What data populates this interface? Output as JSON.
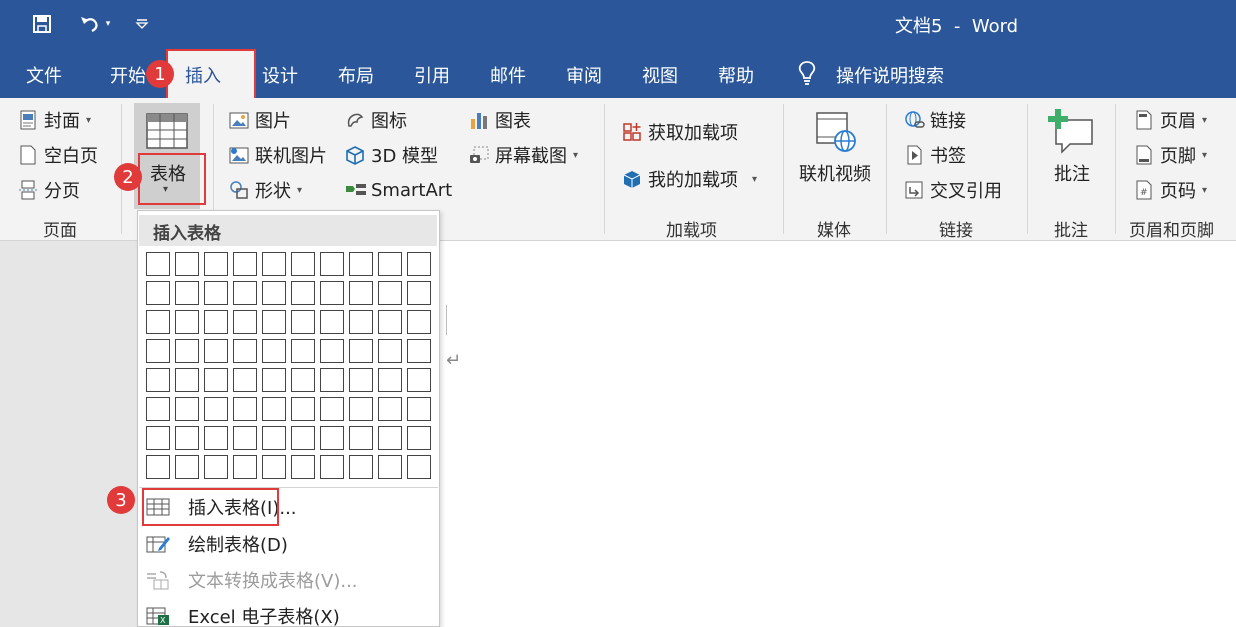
{
  "titlebar": {
    "title": "文档5  -  Word",
    "qat": {
      "save_icon": "save-icon",
      "undo_icon": "undo-icon",
      "customize_icon": "customize-qat-icon"
    }
  },
  "tabs": [
    "文件",
    "开始",
    "插入",
    "设计",
    "布局",
    "引用",
    "邮件",
    "审阅",
    "视图",
    "帮助"
  ],
  "active_tab": "插入",
  "tell_me": "操作说明搜索",
  "ribbon": {
    "pages": {
      "label": "页面",
      "cover": "封面",
      "blank": "空白页",
      "break": "分页"
    },
    "table": {
      "label": "表格"
    },
    "illustrations": {
      "picture": "图片",
      "online_picture": "联机图片",
      "shapes": "形状",
      "icons": "图标",
      "model_3d": "3D 模型",
      "smartart": "SmartArt",
      "chart": "图表",
      "screenshot": "屏幕截图"
    },
    "addins": {
      "label": "加载项",
      "get": "获取加载项",
      "mine": "我的加载项"
    },
    "media": {
      "label": "媒体",
      "online_video": "联机视频"
    },
    "links": {
      "label": "链接",
      "link": "链接",
      "bookmark": "书签",
      "cross_ref": "交叉引用"
    },
    "comments": {
      "label": "批注",
      "comment": "批注"
    },
    "header_footer": {
      "label": "页眉和页脚",
      "header": "页眉",
      "footer": "页脚",
      "page_number": "页码"
    }
  },
  "table_menu": {
    "header": "插入表格",
    "grid_columns": 10,
    "grid_rows": 8,
    "items": [
      {
        "label": "插入表格(I)...",
        "disabled": false
      },
      {
        "label": "绘制表格(D)",
        "disabled": false
      },
      {
        "label": "文本转换成表格(V)...",
        "disabled": true
      },
      {
        "label": "Excel 电子表格(X)",
        "disabled": false
      }
    ]
  },
  "markers": [
    "1",
    "2",
    "3"
  ],
  "colors": {
    "title_blue": "#2b579a",
    "ribbon_bg": "#f3f3f3",
    "highlight_red": "#e03a3a"
  },
  "document": {
    "paragraph_mark": "↵"
  }
}
